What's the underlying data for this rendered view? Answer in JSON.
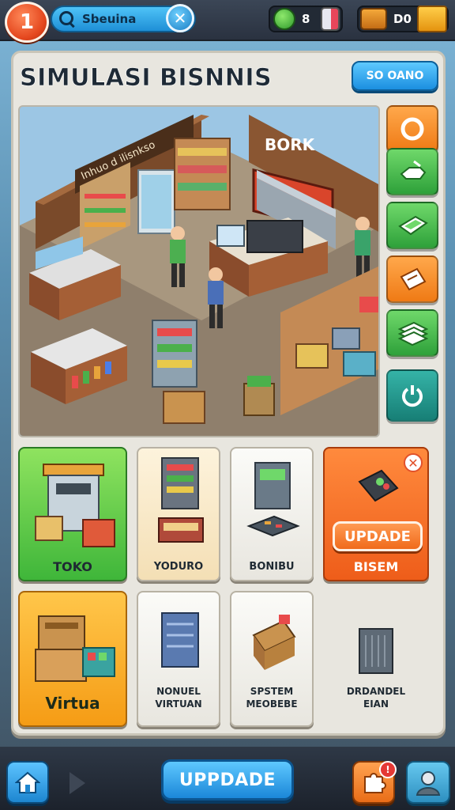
{
  "top_bar": {
    "logo_glyph": "1",
    "search_text": "Sbeuina",
    "close_glyph": "✕",
    "resource_1_value": "8",
    "resource_2_value": "D0"
  },
  "panel": {
    "title": "SIMULASI BISNNIS",
    "header_button": "SO OANO"
  },
  "scene": {
    "wall_sign": "Inhuo d ilisnkso",
    "store_sign": "BORK"
  },
  "side_buttons": [
    {
      "icon": "coin-icon",
      "color": "orange"
    },
    {
      "icon": "hand-icon",
      "color": "green"
    },
    {
      "icon": "cash-icon",
      "color": "green"
    },
    {
      "icon": "note-icon",
      "color": "orange"
    },
    {
      "icon": "stack-icon",
      "color": "green"
    },
    {
      "icon": "power-icon",
      "color": "teal"
    }
  ],
  "cards": {
    "toko": {
      "label": "TOKO"
    },
    "yoduro": {
      "label": "YODURO"
    },
    "bonibu": {
      "label": "BONIBU"
    },
    "update_card": {
      "button": "UPDADE",
      "label": "BISEM",
      "close": "✕"
    },
    "virtua": {
      "label": "Virtua"
    },
    "nonuel": {
      "line1": "NONUEL",
      "line2": "VIRTUAN"
    },
    "sestem": {
      "line1": "SPSTEM",
      "line2": "MEOBEBE"
    },
    "drdandel": {
      "line1": "DRDANDEL",
      "line2": "EIAN"
    }
  },
  "bottom_bar": {
    "update_button": "UPPDADE",
    "badge": "!"
  },
  "colors": {
    "accent_blue": "#1e8fd6",
    "accent_orange": "#ef7a15",
    "accent_green": "#3fb63a",
    "panel_bg": "#e8e6df"
  }
}
